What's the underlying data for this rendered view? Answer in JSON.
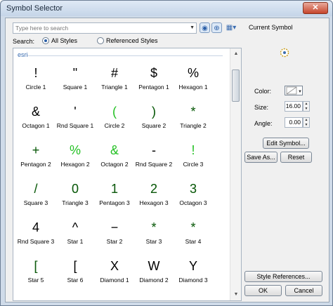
{
  "window": {
    "title": "Symbol Selector",
    "close_glyph": "✕"
  },
  "search": {
    "placeholder": "Type here to search",
    "label": "Search:"
  },
  "scope": {
    "all_styles": "All Styles",
    "referenced_styles": "Referenced Styles",
    "selected": "All Styles"
  },
  "gallery": {
    "group": "esri",
    "symbols": [
      {
        "glyph": "!",
        "name": "Circle 1",
        "style": "black"
      },
      {
        "glyph": "\"",
        "name": "Square 1",
        "style": "black"
      },
      {
        "glyph": "#",
        "name": "Triangle 1",
        "style": "black"
      },
      {
        "glyph": "$",
        "name": "Pentagon 1",
        "style": "black"
      },
      {
        "glyph": "%",
        "name": "Hexagon 1",
        "style": "black"
      },
      {
        "glyph": "&",
        "name": "Octagon 1",
        "style": "black"
      },
      {
        "glyph": "'",
        "name": "Rnd Square 1",
        "style": "black"
      },
      {
        "glyph": "(",
        "name": "Circle 2",
        "style": "green"
      },
      {
        "glyph": ")",
        "name": "Square 2",
        "style": "mixed"
      },
      {
        "glyph": "*",
        "name": "Triangle 2",
        "style": "mixed"
      },
      {
        "glyph": "+",
        "name": "Pentagon 2",
        "style": "mixed"
      },
      {
        "glyph": "%",
        "name": "Hexagon 2",
        "style": "green"
      },
      {
        "glyph": "&",
        "name": "Octagon 2",
        "style": "green"
      },
      {
        "glyph": "-",
        "name": "Rnd Square 2",
        "style": "black"
      },
      {
        "glyph": "!",
        "name": "Circle 3",
        "style": "green"
      },
      {
        "glyph": "/",
        "name": "Square 3",
        "style": "mixed"
      },
      {
        "glyph": "0",
        "name": "Triangle 3",
        "style": "mixed"
      },
      {
        "glyph": "1",
        "name": "Pentagon 3",
        "style": "mixed"
      },
      {
        "glyph": "2",
        "name": "Hexagon 3",
        "style": "mixed"
      },
      {
        "glyph": "3",
        "name": "Octagon 3",
        "style": "mixed"
      },
      {
        "glyph": "4",
        "name": "Rnd Square 3",
        "style": "black"
      },
      {
        "glyph": "^",
        "name": "Star 1",
        "style": "black"
      },
      {
        "glyph": "−",
        "name": "Star 2",
        "style": "black"
      },
      {
        "glyph": "*",
        "name": "Star 3",
        "style": "mixed"
      },
      {
        "glyph": "*",
        "name": "Star 4",
        "style": "mixed"
      },
      {
        "glyph": "[",
        "name": "Star 5",
        "style": "mixed"
      },
      {
        "glyph": "[",
        "name": "Star 6",
        "style": "black"
      },
      {
        "glyph": "X",
        "name": "Diamond 1",
        "style": "black"
      },
      {
        "glyph": "W",
        "name": "Diamond 2",
        "style": "black"
      },
      {
        "glyph": "Y",
        "name": "Diamond 3",
        "style": "black"
      }
    ]
  },
  "current": {
    "title": "Current Symbol",
    "color_label": "Color:",
    "size_label": "Size:",
    "size_value": "16.00",
    "angle_label": "Angle:",
    "angle_value": "0.00"
  },
  "buttons": {
    "edit_symbol": "Edit Symbol...",
    "save_as": "Save As...",
    "reset": "Reset",
    "style_references": "Style References...",
    "ok": "OK",
    "cancel": "Cancel"
  },
  "colors": {
    "accent": "#3a6cb0",
    "symbol_green": "#22c022"
  }
}
